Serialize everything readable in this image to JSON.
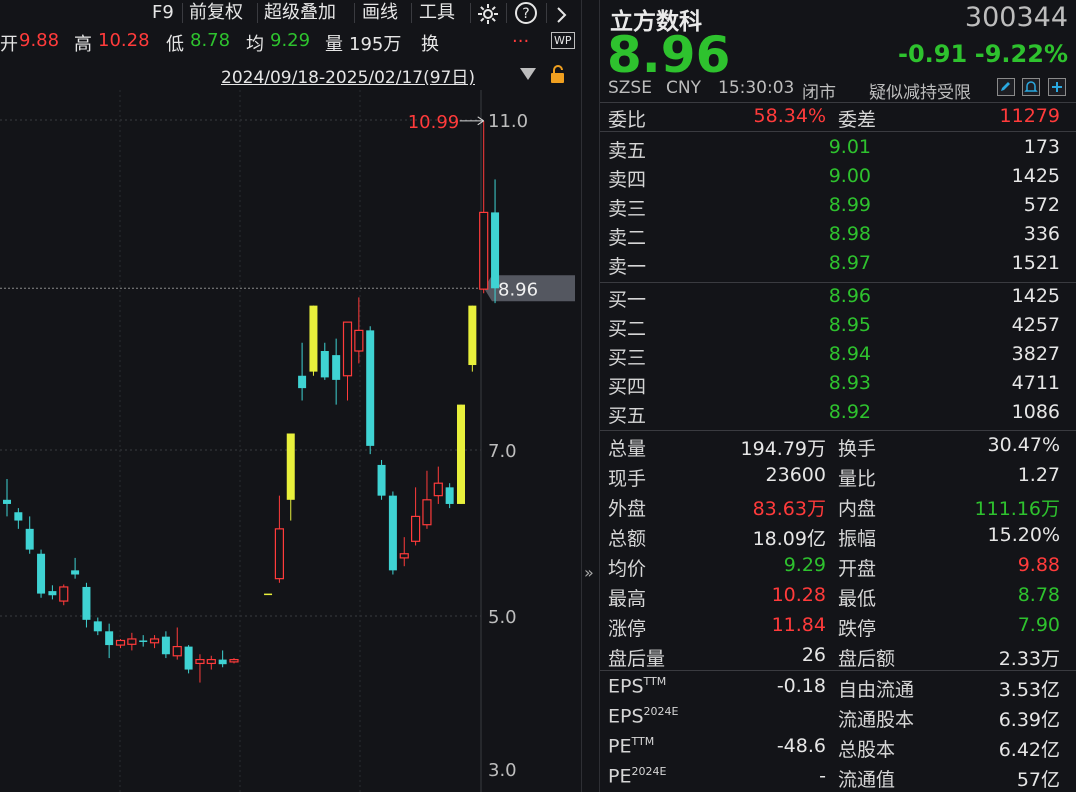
{
  "toolbar": {
    "items": [
      "F9",
      "前复权",
      "超级叠加",
      "画线",
      "工具"
    ],
    "gear_icon": "gear-icon",
    "help_icon": "help-icon",
    "next_icon": "chevron-right-icon"
  },
  "ohlc": {
    "open_label": "开",
    "open_value": "9.88",
    "high_label": "高",
    "high_value": "10.28",
    "low_label": "低",
    "low_value": "8.78",
    "avg_label": "均",
    "avg_value": "9.29",
    "vol_label": "量",
    "vol_value": "195万",
    "turn_label": "换",
    "more": "...",
    "wp_badge": "WP"
  },
  "date_range": "2024/09/18-2025/02/17(97日)",
  "chart_data": {
    "type": "candlestick",
    "y_axis_ticks": [
      "11.0",
      "7.0",
      "5.0",
      "3.0"
    ],
    "y_tick_values": [
      11.0,
      7.0,
      5.0,
      3.0
    ],
    "current_price_label": "8.96",
    "current_price": 8.96,
    "max_annotation": "10.99",
    "max_value": 10.99,
    "candles": [
      {
        "o": 6.4,
        "c": 6.35,
        "h": 6.65,
        "l": 6.2,
        "color": "cyan"
      },
      {
        "o": 6.25,
        "c": 6.15,
        "h": 6.3,
        "l": 6.05,
        "color": "cyan"
      },
      {
        "o": 6.05,
        "c": 5.8,
        "h": 6.2,
        "l": 5.75,
        "color": "cyan"
      },
      {
        "o": 5.75,
        "c": 5.27,
        "h": 5.8,
        "l": 5.22,
        "color": "cyan"
      },
      {
        "o": 5.3,
        "c": 5.25,
        "h": 5.37,
        "l": 5.2,
        "color": "cyan"
      },
      {
        "o": 5.18,
        "c": 5.35,
        "h": 5.38,
        "l": 5.13,
        "color": "red"
      },
      {
        "o": 5.55,
        "c": 5.5,
        "h": 5.7,
        "l": 5.45,
        "color": "cyan"
      },
      {
        "o": 5.35,
        "c": 4.95,
        "h": 5.4,
        "l": 4.85,
        "color": "cyan"
      },
      {
        "o": 4.93,
        "c": 4.8,
        "h": 4.98,
        "l": 4.75,
        "color": "cyan"
      },
      {
        "o": 4.8,
        "c": 4.62,
        "h": 4.9,
        "l": 4.45,
        "color": "cyan"
      },
      {
        "o": 4.62,
        "c": 4.68,
        "h": 4.7,
        "l": 4.58,
        "color": "red"
      },
      {
        "o": 4.63,
        "c": 4.7,
        "h": 4.78,
        "l": 4.55,
        "color": "red"
      },
      {
        "o": 4.68,
        "c": 4.68,
        "h": 4.75,
        "l": 4.6,
        "color": "cyan"
      },
      {
        "o": 4.65,
        "c": 4.7,
        "h": 4.75,
        "l": 4.58,
        "color": "red"
      },
      {
        "o": 4.73,
        "c": 4.5,
        "h": 4.8,
        "l": 4.45,
        "color": "cyan"
      },
      {
        "o": 4.48,
        "c": 4.6,
        "h": 4.85,
        "l": 4.43,
        "color": "red"
      },
      {
        "o": 4.6,
        "c": 4.3,
        "h": 4.62,
        "l": 4.25,
        "color": "cyan"
      },
      {
        "o": 4.38,
        "c": 4.43,
        "h": 4.5,
        "l": 4.13,
        "color": "red"
      },
      {
        "o": 4.38,
        "c": 4.43,
        "h": 4.48,
        "l": 4.3,
        "color": "red"
      },
      {
        "o": 4.43,
        "c": 4.37,
        "h": 4.55,
        "l": 4.33,
        "color": "cyan"
      },
      {
        "o": 4.43,
        "c": 4.4,
        "h": 4.45,
        "l": 4.38,
        "color": "red"
      },
      {
        "o": null,
        "c": null,
        "h": null,
        "l": null,
        "color": "gap"
      },
      {
        "o": null,
        "c": null,
        "h": null,
        "l": null,
        "color": "gap"
      },
      {
        "o": 5.27,
        "c": 5.27,
        "h": 5.27,
        "l": 5.27,
        "color": "yellow"
      },
      {
        "o": 5.45,
        "c": 6.05,
        "h": 6.45,
        "l": 5.4,
        "color": "red"
      },
      {
        "o": 6.4,
        "c": 7.2,
        "h": 7.2,
        "l": 6.15,
        "color": "yellow"
      },
      {
        "o": 7.9,
        "c": 7.75,
        "h": 8.3,
        "l": 7.6,
        "color": "cyan"
      },
      {
        "o": 7.95,
        "c": 8.75,
        "h": 8.75,
        "l": 7.9,
        "color": "yellow"
      },
      {
        "o": 8.2,
        "c": 7.88,
        "h": 8.3,
        "l": 7.85,
        "color": "cyan"
      },
      {
        "o": 8.15,
        "c": 7.85,
        "h": 8.35,
        "l": 7.55,
        "color": "cyan"
      },
      {
        "o": 7.9,
        "c": 8.55,
        "h": 8.55,
        "l": 7.6,
        "color": "red"
      },
      {
        "o": 8.2,
        "c": 8.45,
        "h": 8.85,
        "l": 8.05,
        "color": "red"
      },
      {
        "o": 8.45,
        "c": 7.05,
        "h": 8.5,
        "l": 6.95,
        "color": "cyan"
      },
      {
        "o": 6.82,
        "c": 6.45,
        "h": 6.88,
        "l": 6.4,
        "color": "cyan"
      },
      {
        "o": 6.45,
        "c": 5.55,
        "h": 6.5,
        "l": 5.5,
        "color": "cyan"
      },
      {
        "o": 5.7,
        "c": 5.75,
        "h": 5.95,
        "l": 5.6,
        "color": "red"
      },
      {
        "o": 5.9,
        "c": 6.2,
        "h": 6.55,
        "l": 5.85,
        "color": "red"
      },
      {
        "o": 6.1,
        "c": 6.4,
        "h": 6.75,
        "l": 6.05,
        "color": "red"
      },
      {
        "o": 6.45,
        "c": 6.6,
        "h": 6.8,
        "l": 6.35,
        "color": "red"
      },
      {
        "o": 6.55,
        "c": 6.35,
        "h": 6.6,
        "l": 6.3,
        "color": "cyan"
      },
      {
        "o": 6.35,
        "c": 7.55,
        "h": 7.55,
        "l": 6.35,
        "color": "yellow"
      },
      {
        "o": 8.03,
        "c": 8.75,
        "h": 8.75,
        "l": 7.95,
        "color": "yellow"
      },
      {
        "o": 8.95,
        "c": 9.88,
        "h": 10.99,
        "l": 8.9,
        "color": "red"
      },
      {
        "o": 9.88,
        "c": 8.96,
        "h": 10.28,
        "l": 8.78,
        "color": "cyan"
      }
    ]
  },
  "quote": {
    "name": "立方数科",
    "code": "300344",
    "price": "8.96",
    "change": "-0.91",
    "change_pct": "-9.22%",
    "exchange": "SZSE",
    "currency": "CNY",
    "time": "15:30:03",
    "status": "闭市",
    "note": "疑似减持受限",
    "ratio_label": "委比",
    "ratio_value": "58.34%",
    "diff_label": "委差",
    "diff_value": "11279"
  },
  "asks": [
    {
      "label": "卖五",
      "price": "9.01",
      "vol": "173"
    },
    {
      "label": "卖四",
      "price": "9.00",
      "vol": "1425"
    },
    {
      "label": "卖三",
      "price": "8.99",
      "vol": "572"
    },
    {
      "label": "卖二",
      "price": "8.98",
      "vol": "336"
    },
    {
      "label": "卖一",
      "price": "8.97",
      "vol": "1521"
    }
  ],
  "bids": [
    {
      "label": "买一",
      "price": "8.96",
      "vol": "1425"
    },
    {
      "label": "买二",
      "price": "8.95",
      "vol": "4257"
    },
    {
      "label": "买三",
      "price": "8.94",
      "vol": "3827"
    },
    {
      "label": "买四",
      "price": "8.93",
      "vol": "4711"
    },
    {
      "label": "买五",
      "price": "8.92",
      "vol": "1086"
    }
  ],
  "stats": [
    {
      "l1": "总量",
      "v1": "194.79万",
      "c1": "white",
      "l2": "换手",
      "v2": "30.47%",
      "c2": "white"
    },
    {
      "l1": "现手",
      "v1": "23600",
      "c1": "white",
      "l2": "量比",
      "v2": "1.27",
      "c2": "white"
    },
    {
      "l1": "外盘",
      "v1": "83.63万",
      "c1": "red",
      "l2": "内盘",
      "v2": "111.16万",
      "c2": "green"
    },
    {
      "l1": "总额",
      "v1": "18.09亿",
      "c1": "white",
      "l2": "振幅",
      "v2": "15.20%",
      "c2": "white"
    },
    {
      "l1": "均价",
      "v1": "9.29",
      "c1": "green",
      "l2": "开盘",
      "v2": "9.88",
      "c2": "red"
    },
    {
      "l1": "最高",
      "v1": "10.28",
      "c1": "red",
      "l2": "最低",
      "v2": "8.78",
      "c2": "green"
    },
    {
      "l1": "涨停",
      "v1": "11.84",
      "c1": "red",
      "l2": "跌停",
      "v2": "7.90",
      "c2": "green"
    },
    {
      "l1": "盘后量",
      "v1": "26",
      "c1": "white",
      "l2": "盘后额",
      "v2": "2.33万",
      "c2": "white"
    }
  ],
  "fundamentals": [
    {
      "l1": "EPS",
      "s1": "TTM",
      "v1": "-0.18",
      "l2": "自由流通",
      "v2": "3.53亿"
    },
    {
      "l1": "EPS",
      "s1": "2024E",
      "v1": "",
      "l2": "流通股本",
      "v2": "6.39亿"
    },
    {
      "l1": "PE",
      "s1": "TTM",
      "v1": "-48.6",
      "l2": "总股本",
      "v2": "6.42亿"
    },
    {
      "l1": "PE",
      "s1": "2024E",
      "v1": "-",
      "l2": "流通值",
      "v2": "57亿"
    }
  ],
  "colors": {
    "red": "#ff3b3b",
    "green": "#2ec22e",
    "cyan": "#3fd3d3",
    "yellow": "#e8f03c",
    "bg": "#131418"
  }
}
